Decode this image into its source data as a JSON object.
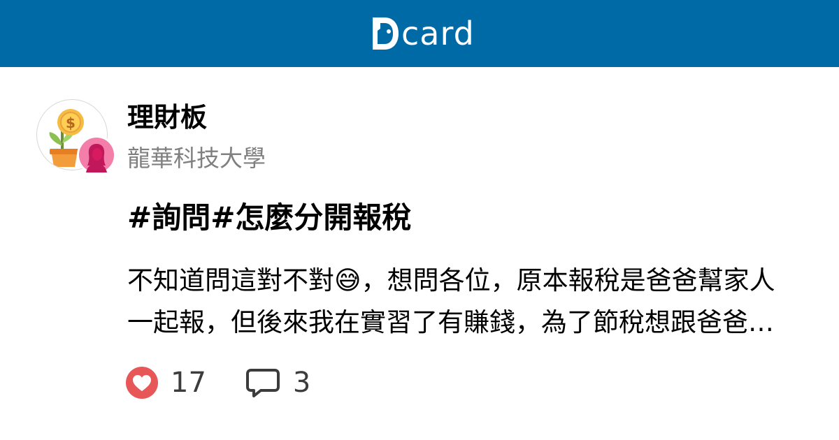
{
  "header": {
    "brand_text": "card",
    "brand_color": "#006aa6"
  },
  "forum": {
    "board_name": "理財板",
    "board_icon": "money-plant-icon",
    "author_school": "龍華科技大學",
    "author_avatar_icon": "female-avatar-icon"
  },
  "post": {
    "title": "#詢問#怎麼分開報稅",
    "excerpt": "不知道問這對不對😅，想問各位，原本報稅是爸爸幫家人一起報，但後來我在實習了有賺錢，為了節稅想跟爸爸分開報稅…"
  },
  "stats": {
    "like_icon": "heart-icon",
    "like_color": "#e85757",
    "likes": "17",
    "comment_icon": "comment-bubble-icon",
    "comments": "3"
  }
}
